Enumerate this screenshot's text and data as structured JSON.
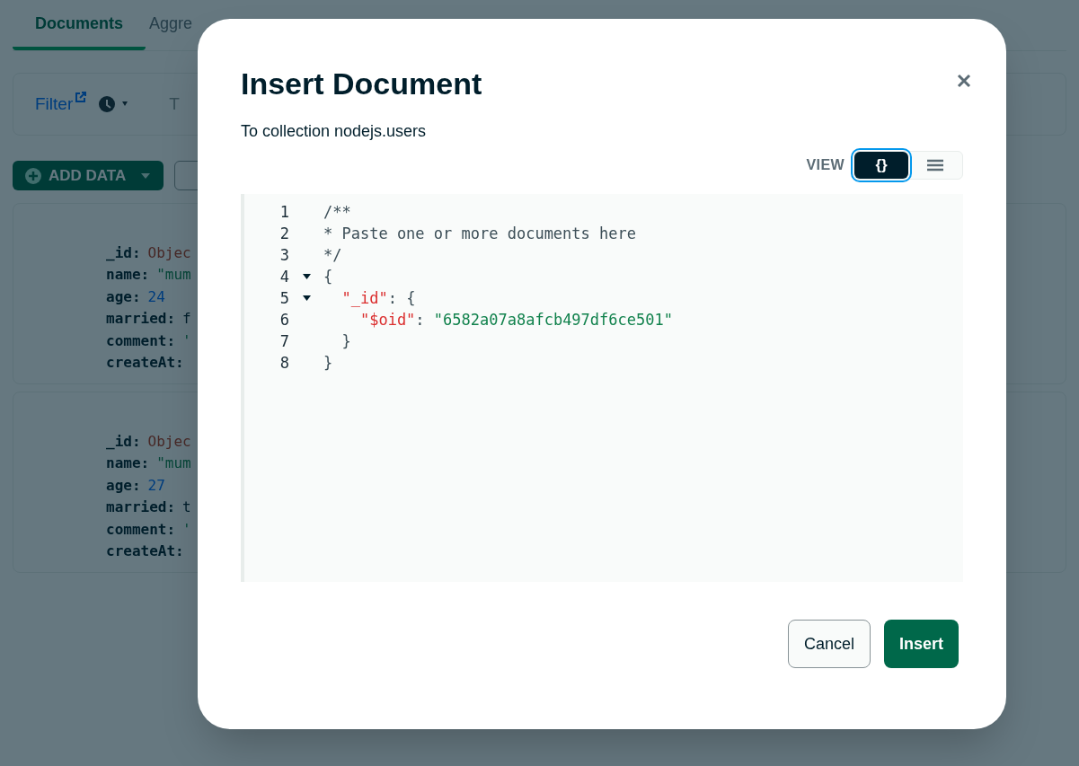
{
  "tabs": [
    {
      "label": "Documents",
      "selected": true
    },
    {
      "label": "Aggre",
      "selected": false
    }
  ],
  "toolbar": {
    "filter_link": "Filter",
    "query_hint": "T"
  },
  "add_data": {
    "label": "ADD DATA"
  },
  "documents": [
    {
      "fields": [
        {
          "key": "_id:",
          "value": "Objec",
          "kind": "objectid"
        },
        {
          "key": "name:",
          "value": "\"mum",
          "kind": "string"
        },
        {
          "key": "age:",
          "value": "24",
          "kind": "number"
        },
        {
          "key": "married:",
          "value": "f",
          "kind": "boolean"
        },
        {
          "key": "comment:",
          "value": "'",
          "kind": "string"
        },
        {
          "key": "createAt:"
        }
      ]
    },
    {
      "fields": [
        {
          "key": "_id:",
          "value": "Objec",
          "kind": "objectid"
        },
        {
          "key": "name:",
          "value": "\"mum",
          "kind": "string"
        },
        {
          "key": "age:",
          "value": "27",
          "kind": "number"
        },
        {
          "key": "married:",
          "value": "t",
          "kind": "boolean"
        },
        {
          "key": "comment:",
          "value": "'",
          "kind": "string"
        },
        {
          "key": "createAt:"
        }
      ]
    }
  ],
  "modal": {
    "title": "Insert Document",
    "subtitle": "To collection nodejs.users",
    "view_label": "VIEW",
    "view_options": [
      {
        "kind": "json",
        "label": "{}",
        "selected": true
      },
      {
        "kind": "list",
        "selected": false
      }
    ],
    "editor_lines": [
      {
        "number": "1",
        "foldable": false,
        "tokens": [
          {
            "kind": "comment",
            "text": "/**"
          }
        ]
      },
      {
        "number": "2",
        "foldable": false,
        "tokens": [
          {
            "kind": "comment",
            "text": "* Paste one or more documents here"
          }
        ]
      },
      {
        "number": "3",
        "foldable": false,
        "tokens": [
          {
            "kind": "comment",
            "text": "*/"
          }
        ]
      },
      {
        "number": "4",
        "foldable": true,
        "tokens": [
          {
            "kind": "punct",
            "text": "{"
          }
        ]
      },
      {
        "number": "5",
        "foldable": true,
        "tokens": [
          {
            "kind": "key",
            "text": "  \"_id\""
          },
          {
            "kind": "punct",
            "text": ": {"
          }
        ]
      },
      {
        "number": "6",
        "foldable": false,
        "tokens": [
          {
            "kind": "key",
            "text": "    \"$oid\""
          },
          {
            "kind": "punct",
            "text": ": "
          },
          {
            "kind": "string",
            "text": "\"6582a07a8afcb497df6ce501\""
          }
        ]
      },
      {
        "number": "7",
        "foldable": false,
        "tokens": [
          {
            "kind": "punct",
            "text": "  }"
          }
        ]
      },
      {
        "number": "8",
        "foldable": false,
        "tokens": [
          {
            "kind": "punct",
            "text": "}"
          }
        ]
      }
    ],
    "buttons": [
      {
        "kind": "secondary",
        "label": "Cancel"
      },
      {
        "kind": "primary",
        "label": "Insert"
      }
    ]
  }
}
